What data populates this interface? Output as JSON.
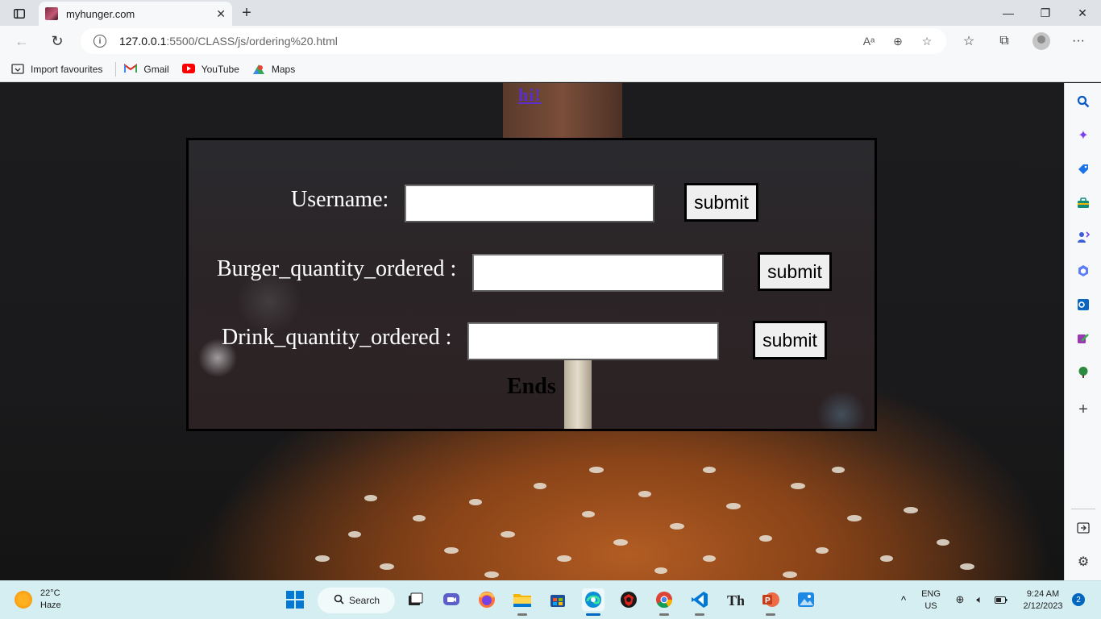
{
  "browser": {
    "tab_title": "myhunger.com",
    "url_host": "127.0.0.1",
    "url_path": ":5500/CLASS/js/ordering%20.html",
    "bookmarks": [
      "Import favourites",
      "Gmail",
      "YouTube",
      "Maps"
    ]
  },
  "page": {
    "heading": "hi!",
    "form": {
      "username_label": "Username:",
      "burger_label": "Burger_quantity_ordered :",
      "drink_label": "Drink_quantity_ordered :",
      "username_value": "",
      "burger_value": "",
      "drink_value": "",
      "submit_label": "submit",
      "ends_text": "Ends"
    }
  },
  "taskbar": {
    "weather_temp": "22°C",
    "weather_cond": "Haze",
    "search_label": "Search",
    "lang_top": "ENG",
    "lang_bottom": "US",
    "time": "9:24 AM",
    "date": "2/12/2023",
    "notification_count": "2"
  },
  "colors": {
    "heading": "#5a2ecf",
    "form_border": "#000000",
    "taskbar_bg": "#d4eef2"
  }
}
